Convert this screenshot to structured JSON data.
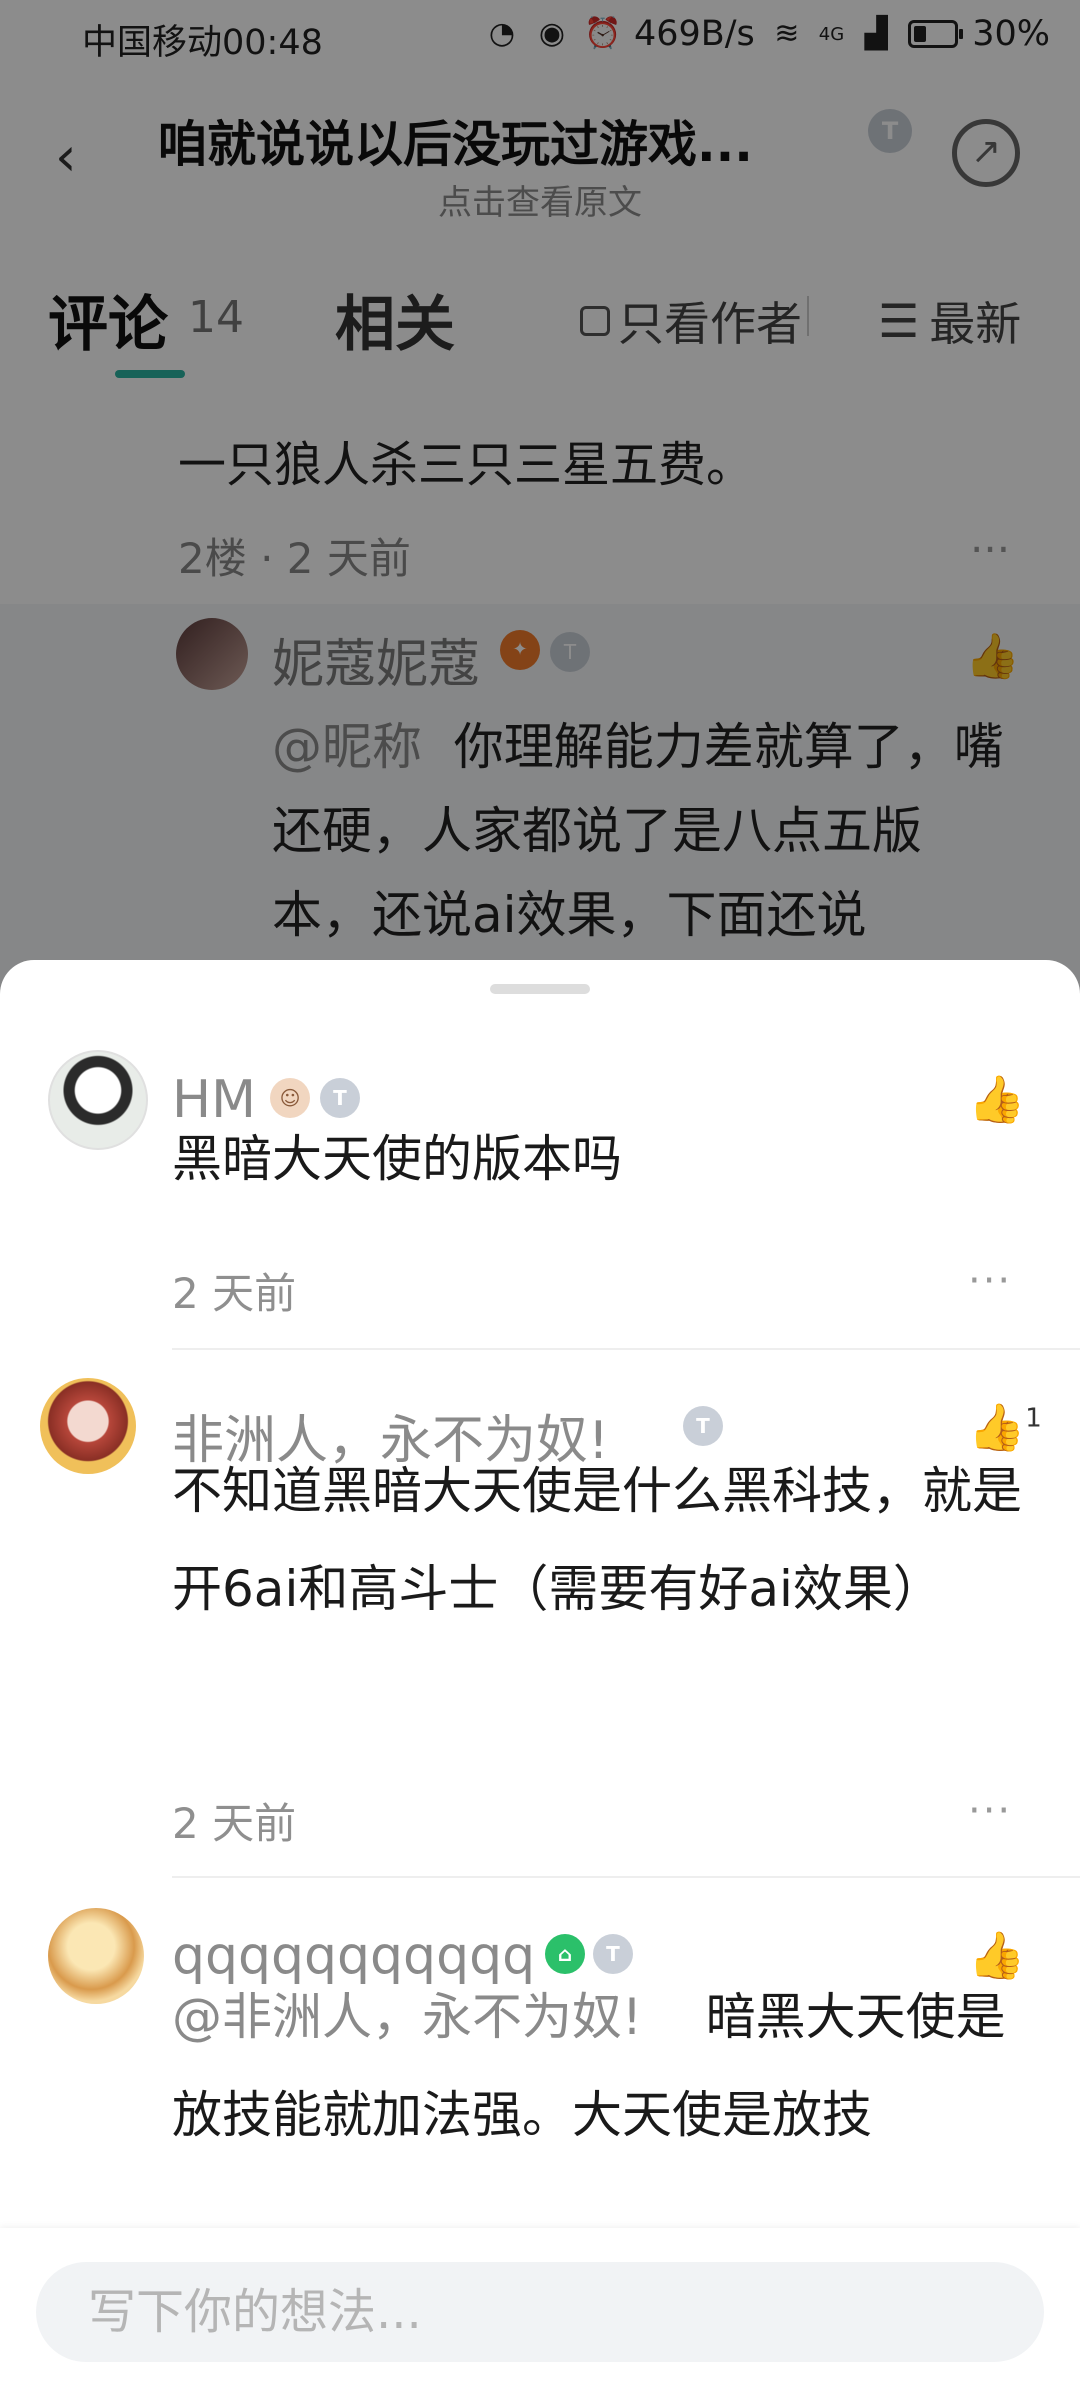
{
  "status_bar": {
    "carrier": "中国移动",
    "time": "00:48",
    "net_speed": "469B/s",
    "network": "4G",
    "battery": "30%"
  },
  "header": {
    "title": "咱就说说以后没玩过游戏...",
    "subtitle": "点击查看原文",
    "title_badge": "T"
  },
  "tabs": {
    "comments_label": "评论",
    "comments_count": "14",
    "related_label": "相关",
    "author_only_label": "只看作者",
    "sort_label": "最新"
  },
  "background_comment": {
    "text_line": "一只狼人杀三只三星五费。",
    "floor_meta": "2楼 · 2 天前",
    "reply": {
      "author": "妮蔻妮蔻",
      "mention": "@昵称",
      "text": "你理解能力差就算了，嘴还硬，人家都说了是八点五版本，还说ai效果，下面还说"
    }
  },
  "comments": [
    {
      "author": "HM",
      "text": "黑暗大天使的版本吗",
      "time": "2 天前",
      "likes": ""
    },
    {
      "author": "非洲人，永不为奴!",
      "text": "不知道黑暗大天使是什么黑科技，就是开6ai和高斗士（需要有好ai效果）",
      "time": "2 天前",
      "likes": "1"
    },
    {
      "author": "qqqqqqqqqqq",
      "mention": "@非洲人，永不为奴!",
      "text": "暗黑大天使是放技能就加法强。大天使是放技",
      "time": "",
      "likes": ""
    }
  ],
  "input": {
    "placeholder": "写下你的想法..."
  },
  "icons": {
    "back": "back-arrow-icon",
    "share": "share-icon",
    "like": "thumbs-up-icon",
    "more": "more-dots-icon"
  },
  "colors": {
    "accent": "#2bb3a0",
    "overlay": "rgba(0,0,0,0.45)"
  }
}
